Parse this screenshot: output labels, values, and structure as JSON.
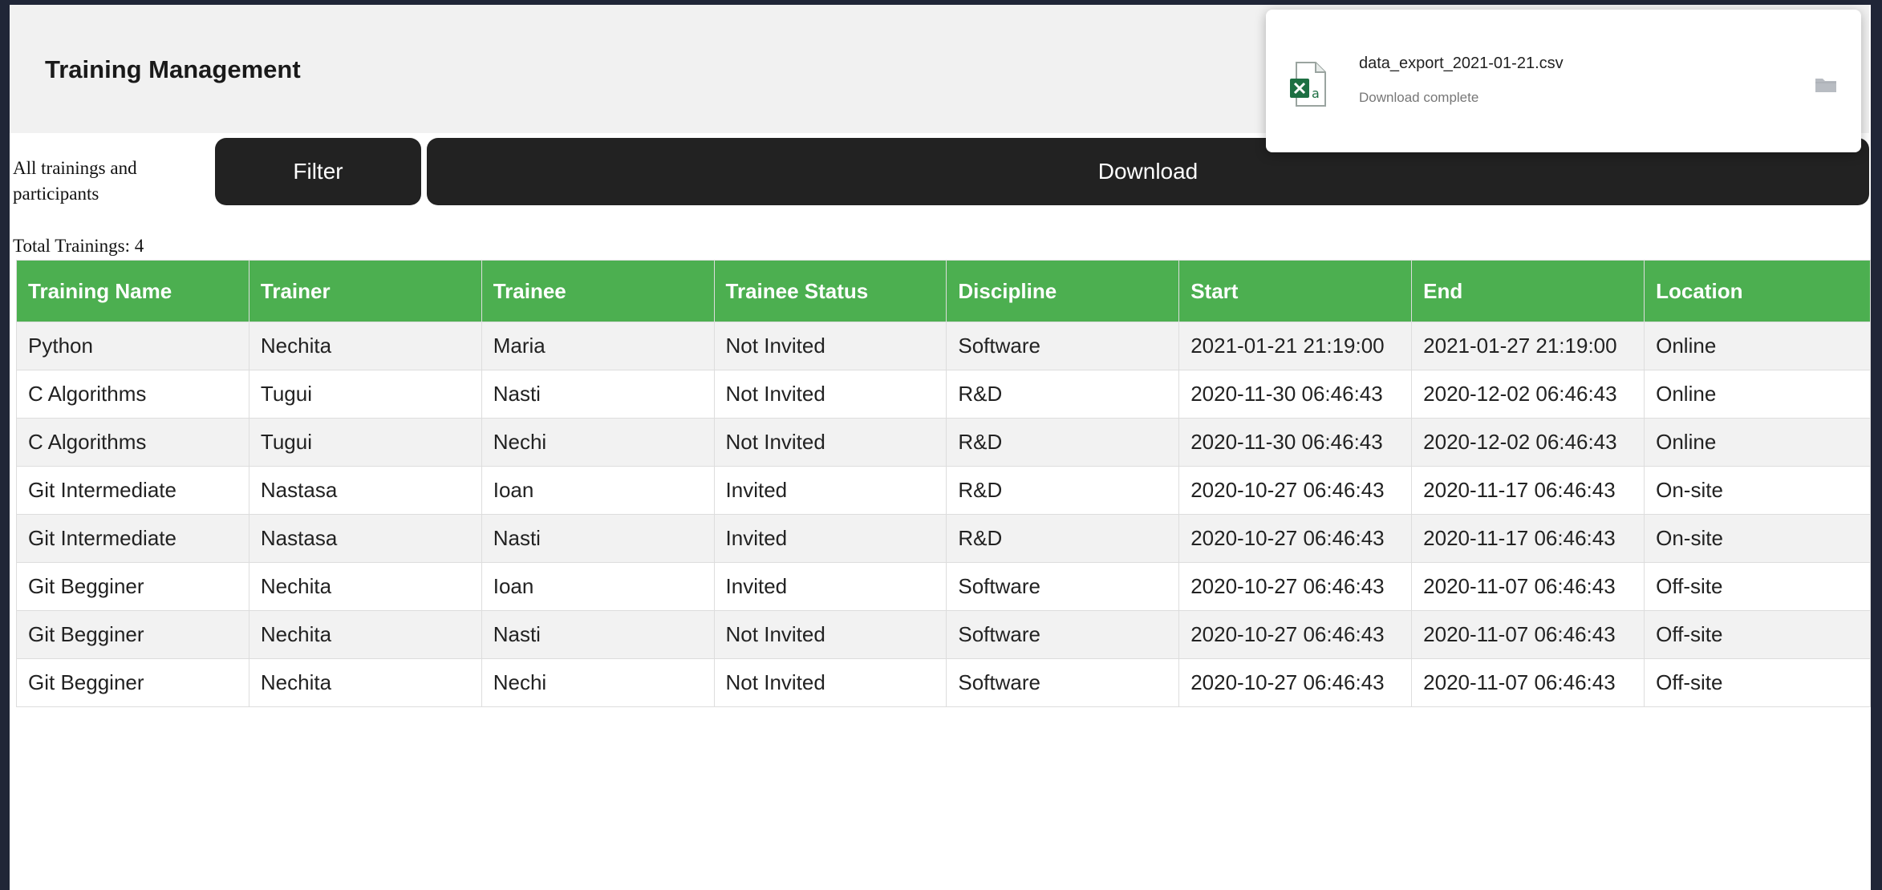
{
  "header": {
    "title": "Training Management"
  },
  "controls": {
    "label": "All trainings and participants",
    "filter_label": "Filter",
    "download_label": "Download"
  },
  "summary": {
    "total_text": "Total Trainings: 4"
  },
  "table": {
    "columns": [
      "Training Name",
      "Trainer",
      "Trainee",
      "Trainee Status",
      "Discipline",
      "Start",
      "End",
      "Location"
    ],
    "rows": [
      [
        "Python",
        "Nechita",
        "Maria",
        "Not Invited",
        "Software",
        "2021-01-21 21:19:00",
        "2021-01-27 21:19:00",
        "Online"
      ],
      [
        "C Algorithms",
        "Tugui",
        "Nasti",
        "Not Invited",
        "R&D",
        "2020-11-30 06:46:43",
        "2020-12-02 06:46:43",
        "Online"
      ],
      [
        "C Algorithms",
        "Tugui",
        "Nechi",
        "Not Invited",
        "R&D",
        "2020-11-30 06:46:43",
        "2020-12-02 06:46:43",
        "Online"
      ],
      [
        "Git Intermediate",
        "Nastasa",
        "Ioan",
        "Invited",
        "R&D",
        "2020-10-27 06:46:43",
        "2020-11-17 06:46:43",
        "On-site"
      ],
      [
        "Git Intermediate",
        "Nastasa",
        "Nasti",
        "Invited",
        "R&D",
        "2020-10-27 06:46:43",
        "2020-11-17 06:46:43",
        "On-site"
      ],
      [
        "Git Begginer",
        "Nechita",
        "Ioan",
        "Invited",
        "Software",
        "2020-10-27 06:46:43",
        "2020-11-07 06:46:43",
        "Off-site"
      ],
      [
        "Git Begginer",
        "Nechita",
        "Nasti",
        "Not Invited",
        "Software",
        "2020-10-27 06:46:43",
        "2020-11-07 06:46:43",
        "Off-site"
      ],
      [
        "Git Begginer",
        "Nechita",
        "Nechi",
        "Not Invited",
        "Software",
        "2020-10-27 06:46:43",
        "2020-11-07 06:46:43",
        "Off-site"
      ]
    ]
  },
  "download_popup": {
    "filename": "data_export_2021-01-21.csv",
    "status": "Download complete",
    "file_icon": "excel-file-icon",
    "folder_icon": "folder-icon"
  },
  "colors": {
    "table_header": "#4caf50",
    "button": "#222222",
    "frame": "#202637"
  }
}
